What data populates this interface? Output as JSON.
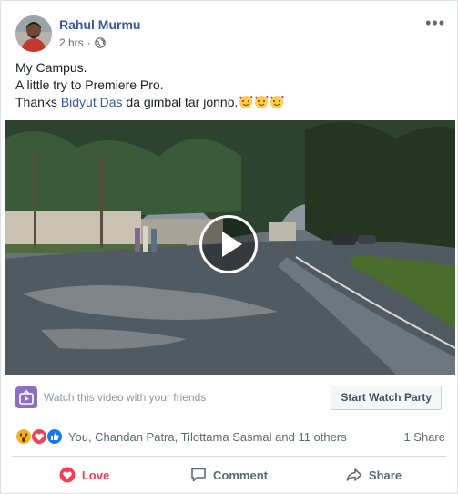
{
  "post": {
    "author": "Rahul Murmu",
    "time": "2 hrs",
    "privacy_icon": "globe-icon",
    "more_label": "•••",
    "text_line1": "My Campus.",
    "text_line2": "A little try to Premiere Pro.",
    "text_line3_prefix": "Thanks ",
    "mention": "Bidyut Das",
    "text_line3_suffix": " da gimbal tar jonno."
  },
  "watch_party": {
    "prompt": "Watch this video with your friends",
    "button": "Start Watch Party"
  },
  "reactions": {
    "summary": "You, Chandan Patra, Tilottama Sasmal and 11 others",
    "shares": "1 Share",
    "icons": [
      "wow-icon",
      "love-icon",
      "like-icon"
    ]
  },
  "actions": {
    "love": "Love",
    "comment": "Comment",
    "share": "Share"
  },
  "colors": {
    "link": "#365899",
    "love": "#f33e58",
    "like": "#1877f2",
    "wow": "#f7b125"
  }
}
